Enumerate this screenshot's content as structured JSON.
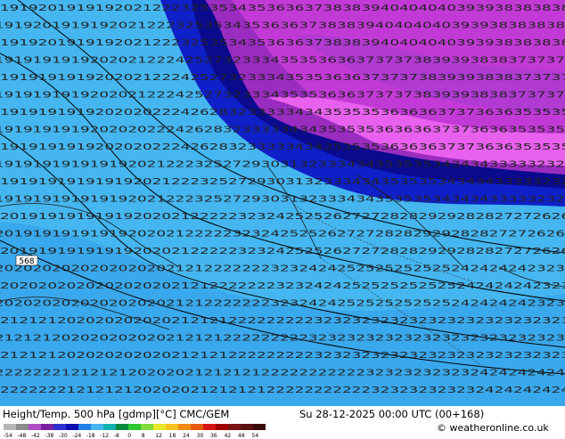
{
  "header": {
    "title": "Height/Temp. 500 hPa [gdmp][°C] CMC/GEM",
    "valid": "Su 28-12-2025 00:00 UTC (00+168)",
    "credit": "© weatheronline.co.uk"
  },
  "map": {
    "contour_label": "568",
    "sample_rows": [
      "19 19 20 19 19 19 20 21 22 23 25 35 34 35 36 36 37 38 38 39 40 40 40 40 39 39 38 38 38 38",
      "19 19 19 19 19 20 20 21 22 24 25 27 32 33 34 35 35 36 36 37 37 37 38 39 39 38 38 37 37 37",
      "19 19 19 19 19 20 20 20 22 24 26 28 32 33 33 34 34 35 35 35 36 36 36 37 37 36 36 35 35 35",
      "19 19 19 19 19 19 19 20 21 22 23 25 27 29 30 31 32 33 34 34 35 35 35 34 34 34 33 33 32 32",
      "20 19 19 19 19 19 19 20 20 21 22 22 23 23 24 25 25 26 27 27 28 28 29 29 28 28 27 27 26 26",
      "20 20 20 20 20 20 20 20 20 21 21 22 22 22 23 23 24 24 25 25 25 25 25 25 24 24 24 24 23 23",
      "21 21 21 20 20 20 20 20 20 21 21 21 22 22 22 22 23 23 23 23 23 23 23 23 23 23 23 23 23 23",
      "22 22 22 21 21 21 21 20 20 20 21 21 21 21 22 22 22 22 22 23 23 23 23 23 23 24 24 24 24 24"
    ]
  },
  "scale": {
    "colors": [
      "#b5b5b5",
      "#8c8c8c",
      "#b14ec7",
      "#7a1fa0",
      "#2f2fd0",
      "#0d0db0",
      "#1f7fe6",
      "#45b6f0",
      "#12b2b2",
      "#0a8a3c",
      "#2ec82e",
      "#7fdc3c",
      "#e8e82a",
      "#f4c21c",
      "#f08a12",
      "#e85a0e",
      "#d61414",
      "#a00000",
      "#7a1414",
      "#5a1010",
      "#3a0a0a"
    ],
    "labels": [
      "-54",
      "-48",
      "-42",
      "-38",
      "-30",
      "-24",
      "-18",
      "-12",
      "-8",
      "0",
      "8",
      "12",
      "18",
      "24",
      "30",
      "36",
      "42",
      "48",
      "54"
    ]
  }
}
